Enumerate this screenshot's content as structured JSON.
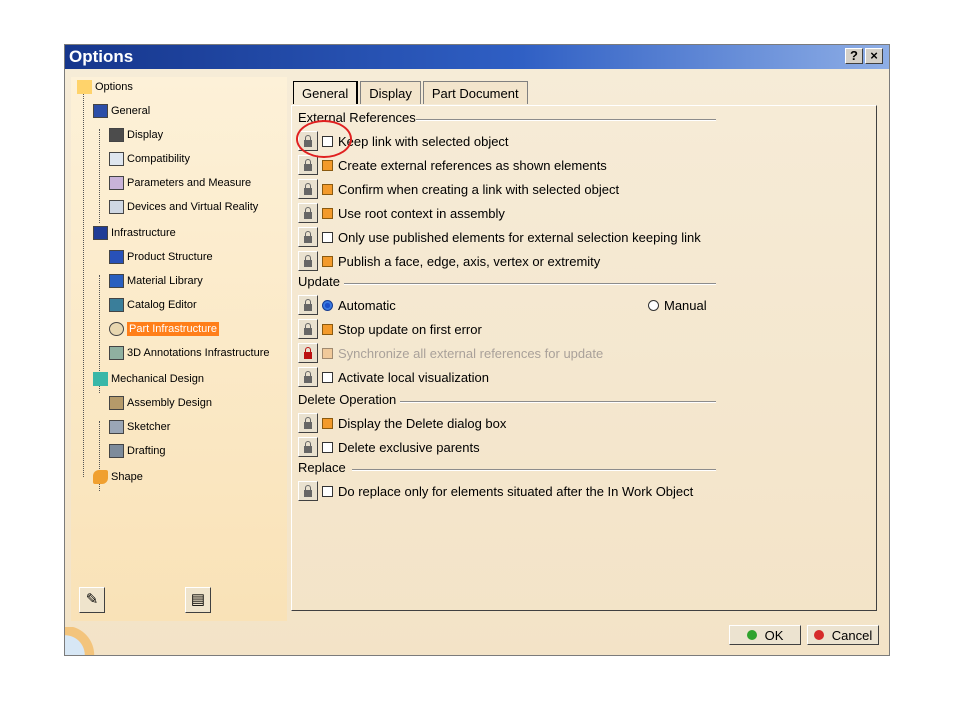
{
  "window": {
    "title": "Options",
    "help_label": "?",
    "close_label": "×"
  },
  "tree": {
    "root": "Options",
    "items": [
      {
        "label": "General",
        "level": 1
      },
      {
        "label": "Display",
        "level": 2
      },
      {
        "label": "Compatibility",
        "level": 2
      },
      {
        "label": "Parameters and Measure",
        "level": 2
      },
      {
        "label": "Devices and Virtual Reality",
        "level": 2
      },
      {
        "label": "Infrastructure",
        "level": 1
      },
      {
        "label": "Product Structure",
        "level": 2
      },
      {
        "label": "Material Library",
        "level": 2
      },
      {
        "label": "Catalog Editor",
        "level": 2
      },
      {
        "label": "Part Infrastructure",
        "level": 2,
        "selected": true
      },
      {
        "label": "3D Annotations Infrastructure",
        "level": 2
      },
      {
        "label": "Mechanical Design",
        "level": 1
      },
      {
        "label": "Assembly Design",
        "level": 2
      },
      {
        "label": "Sketcher",
        "level": 2
      },
      {
        "label": "Drafting",
        "level": 2
      },
      {
        "label": "Shape",
        "level": 1
      }
    ]
  },
  "tabs": [
    {
      "label": "General",
      "active": true
    },
    {
      "label": "Display",
      "active": false
    },
    {
      "label": "Part Document",
      "active": false
    }
  ],
  "groups": {
    "external_references": {
      "title": "External References",
      "options": [
        {
          "label": "Keep link with selected object",
          "checked": false
        },
        {
          "label": "Create external references as shown elements",
          "checked": true
        },
        {
          "label": "Confirm when creating a link with selected object",
          "checked": true
        },
        {
          "label": "Use root context in assembly",
          "checked": true
        },
        {
          "label": "Only use published elements for external selection keeping link",
          "checked": false
        },
        {
          "label": "Publish a face, edge, axis, vertex or extremity",
          "checked": true
        }
      ]
    },
    "update": {
      "title": "Update",
      "radio_automatic": "Automatic",
      "radio_manual": "Manual",
      "selected": "Automatic",
      "options": [
        {
          "label": "Stop update on first error",
          "checked": true
        },
        {
          "label": "Synchronize all external references for update",
          "checked": true,
          "disabled": true
        },
        {
          "label": "Activate local visualization",
          "checked": false
        }
      ]
    },
    "delete_operation": {
      "title": "Delete Operation",
      "options": [
        {
          "label": "Display the Delete dialog box",
          "checked": true
        },
        {
          "label": "Delete exclusive parents",
          "checked": false
        }
      ]
    },
    "replace": {
      "title": "Replace",
      "options": [
        {
          "label": "Do replace only for elements situated after the In Work Object",
          "checked": false
        }
      ]
    }
  },
  "buttons": {
    "ok": "OK",
    "cancel": "Cancel"
  },
  "colors": {
    "selection": "#ff7f1a",
    "titlebar": "#16368c",
    "checkbox_on": "#f39a2b",
    "ok_dot": "#2fa32f",
    "cancel_dot": "#d62b2b"
  }
}
